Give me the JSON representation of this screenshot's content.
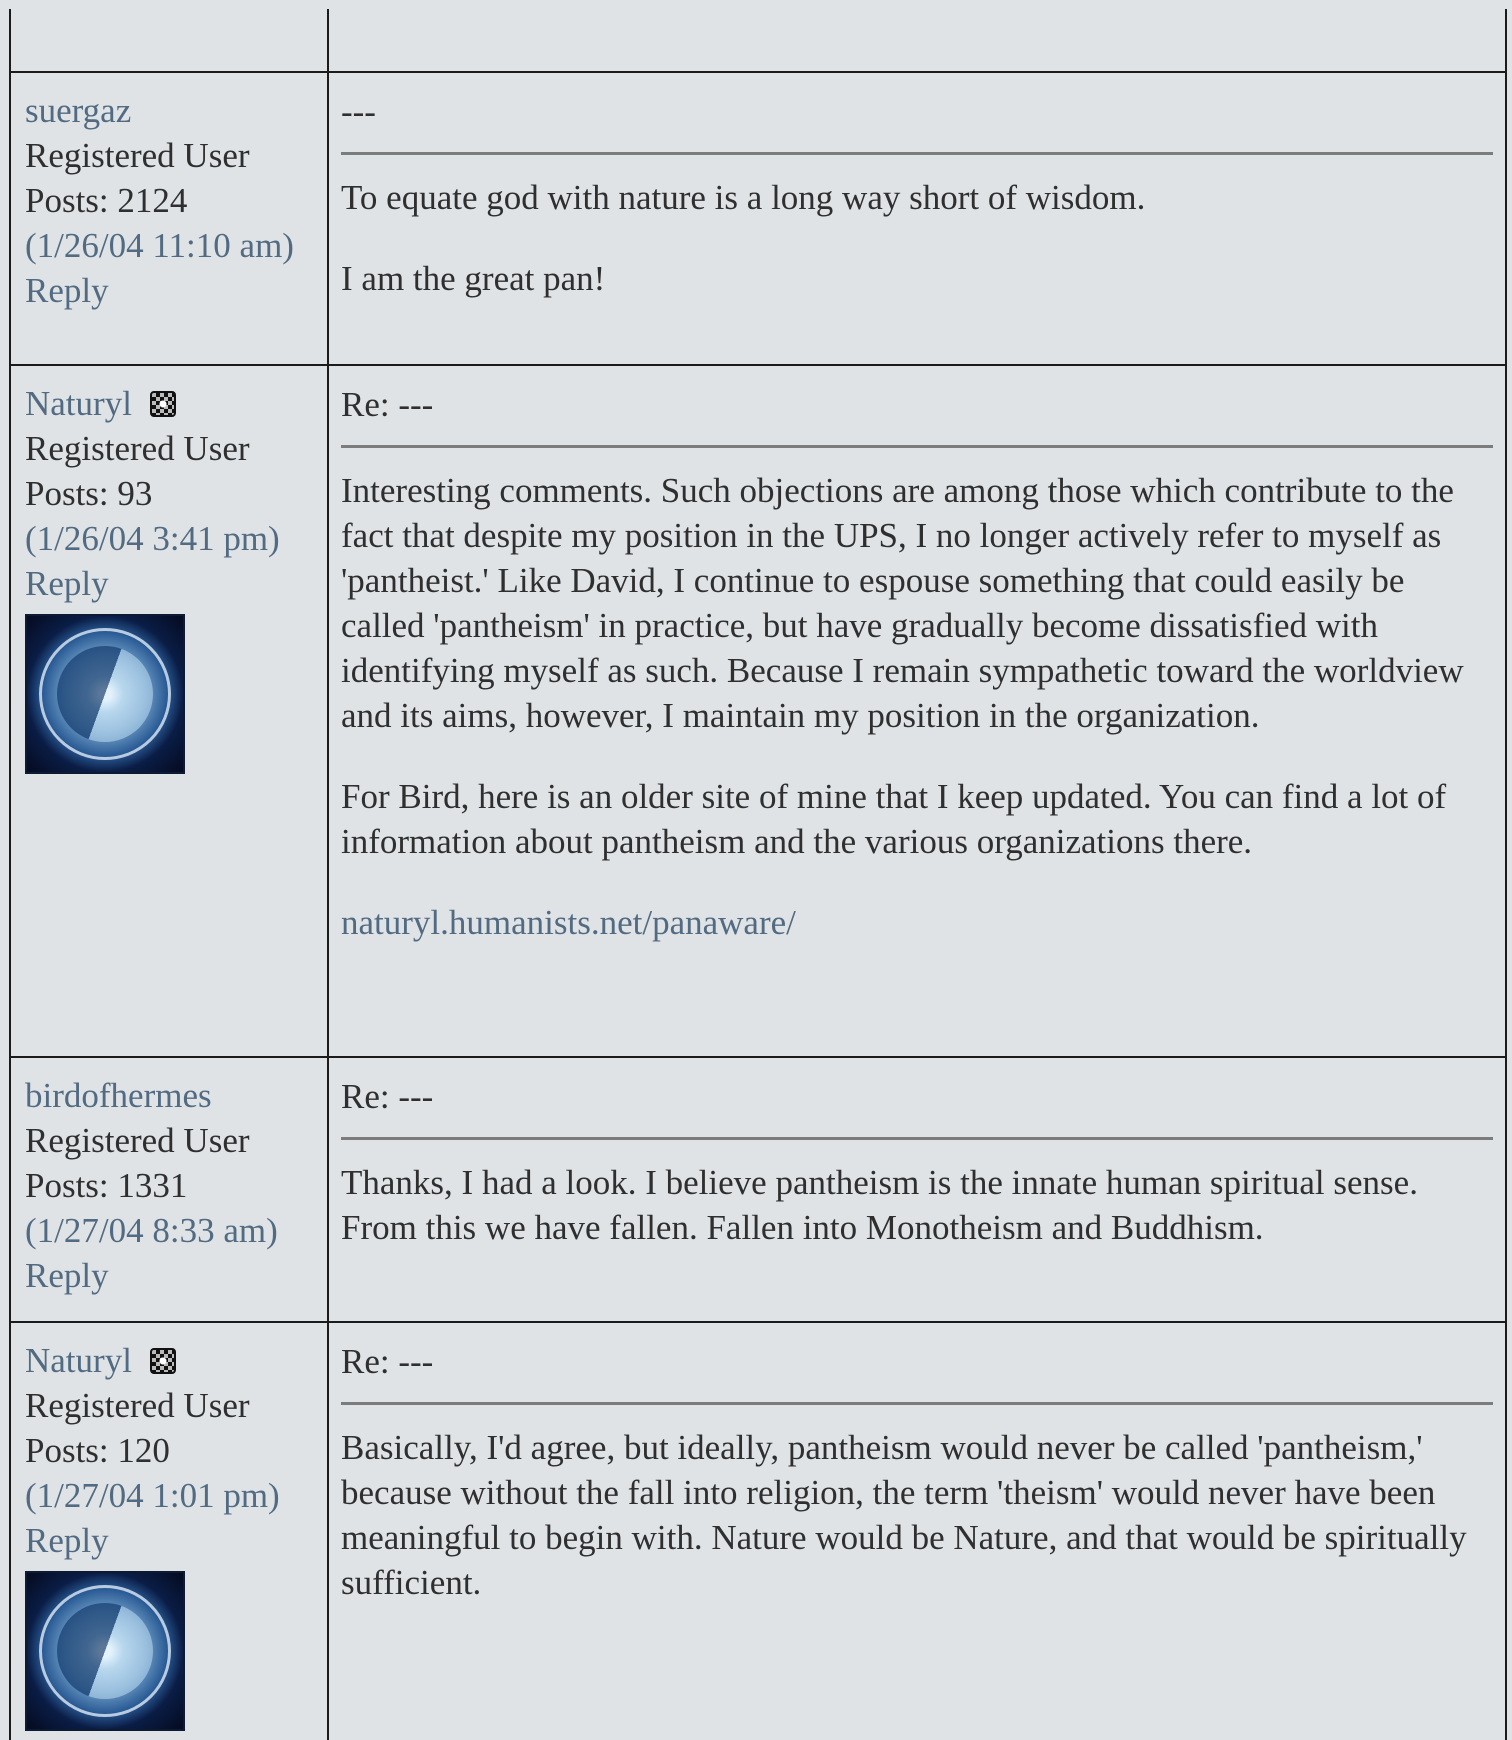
{
  "posts": [
    {
      "username": "suergaz",
      "role": "Registered User",
      "posts": "Posts: 2124",
      "timestamp": "(1/26/04 11:10 am)",
      "reply": "Reply",
      "title": "---",
      "paragraphs": [
        "To equate god with nature is a long way short of wisdom.",
        "I am the great pan!"
      ]
    },
    {
      "username": "Naturyl",
      "role": "Registered User",
      "posts": "Posts: 93",
      "timestamp": "(1/26/04 3:41 pm)",
      "reply": "Reply",
      "title": "Re: ---",
      "paragraphs": [
        "Interesting comments. Such objections are among those which contribute to the fact that despite my position in the UPS, I no longer actively refer to myself as 'pantheist.' Like David, I continue to espouse something that could easily be called 'pantheism' in practice, but have gradually become dissatisfied with identifying myself as such. Because I remain sympathetic toward the worldview and its aims, however, I maintain my position in the organization.",
        "For Bird, here is an older site of mine that I keep updated. You can find a lot of information about pantheism and the various organizations there."
      ],
      "link": "naturyl.humanists.net/panaware/"
    },
    {
      "username": "birdofhermes",
      "role": "Registered User",
      "posts": "Posts: 1331",
      "timestamp": "(1/27/04 8:33 am)",
      "reply": "Reply",
      "title": "Re: ---",
      "paragraphs": [
        "Thanks, I had a look. I believe pantheism is the innate human spiritual sense. From this we have fallen. Fallen into Monotheism and Buddhism."
      ]
    },
    {
      "username": "Naturyl",
      "role": "Registered User",
      "posts": "Posts: 120",
      "timestamp": "(1/27/04 1:01 pm)",
      "reply": "Reply",
      "title": "Re: ---",
      "paragraphs": [
        "Basically, I'd agree, but ideally, pantheism would never be called 'pantheism,' because without the fall into religion, the term 'theism' would never have been meaningful to begin with. Nature would be Nature, and that would be spiritually sufficient."
      ]
    }
  ],
  "colors": {
    "background": "#dfe3e6",
    "link": "#526b82",
    "text": "#2f2f2f",
    "border": "#1b1b1b",
    "divider": "#7c7c7c"
  },
  "icons": [
    "status-icon",
    "avatar-image"
  ]
}
